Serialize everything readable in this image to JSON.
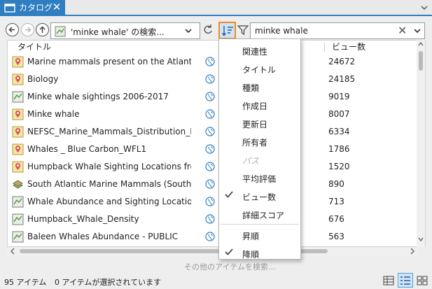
{
  "tab": {
    "title": "カタログ",
    "close": "✕",
    "overflow": "⌄"
  },
  "toolbar": {
    "location_text": "'minke whale' の検索...",
    "search_value": "minke whale",
    "search_clear": "✕",
    "caret": "⌄",
    "refresh": "↻"
  },
  "columns": {
    "title": "タイトル",
    "views": "ビュー数"
  },
  "items": [
    {
      "title": "Marine mammals present on the Atlantic c...",
      "views": "24672",
      "icon": "map-icon"
    },
    {
      "title": "Biology",
      "views": "24185",
      "icon": "map-icon"
    },
    {
      "title": "Minke whale sightings 2006-2017",
      "views": "9019",
      "icon": "layer-icon"
    },
    {
      "title": "Minke whale",
      "views": "8007",
      "icon": "map-icon"
    },
    {
      "title": "NEFSC_Marine_Mammals_Distribution_Lay...",
      "views": "6334",
      "icon": "map-icon"
    },
    {
      "title": "Whales _ Blue Carbon_WFL1",
      "views": "1786",
      "icon": "map-icon"
    },
    {
      "title": "Humpback Whale Sighting Locations from...",
      "views": "1520",
      "icon": "map-icon"
    },
    {
      "title": "South Atlantic Marine Mammals (Southeast...",
      "views": "890",
      "icon": "scene-icon"
    },
    {
      "title": "Whale Abundance and Sighting Locations",
      "views": "713",
      "icon": "layer-icon"
    },
    {
      "title": "Humpback_Whale_Density",
      "views": "676",
      "icon": "layer-icon"
    },
    {
      "title": "Baleen Whales Abundance - PUBLIC",
      "views": "563",
      "icon": "layer-icon"
    }
  ],
  "sort_menu": {
    "fields": [
      {
        "label": "関連性",
        "checked": false,
        "disabled": false
      },
      {
        "label": "タイトル",
        "checked": false,
        "disabled": false
      },
      {
        "label": "種類",
        "checked": false,
        "disabled": false
      },
      {
        "label": "作成日",
        "checked": false,
        "disabled": false
      },
      {
        "label": "更新日",
        "checked": false,
        "disabled": false
      },
      {
        "label": "所有者",
        "checked": false,
        "disabled": false
      },
      {
        "label": "パス",
        "checked": false,
        "disabled": true
      },
      {
        "label": "平均評価",
        "checked": false,
        "disabled": false
      },
      {
        "label": "ビュー数",
        "checked": true,
        "disabled": false
      },
      {
        "label": "詳細スコア",
        "checked": false,
        "disabled": false
      }
    ],
    "order": [
      {
        "label": "昇順",
        "checked": false,
        "disabled": false
      },
      {
        "label": "降順",
        "checked": true,
        "disabled": false
      }
    ]
  },
  "more_search": "その他のアイテムを検索...",
  "status": {
    "count": "95 アイテム",
    "selected": "0 アイテムが選択されています"
  },
  "colors": {
    "accent": "#2e7ec1",
    "highlight": "#f08a1f",
    "selected_bg": "#cfe4f6"
  }
}
